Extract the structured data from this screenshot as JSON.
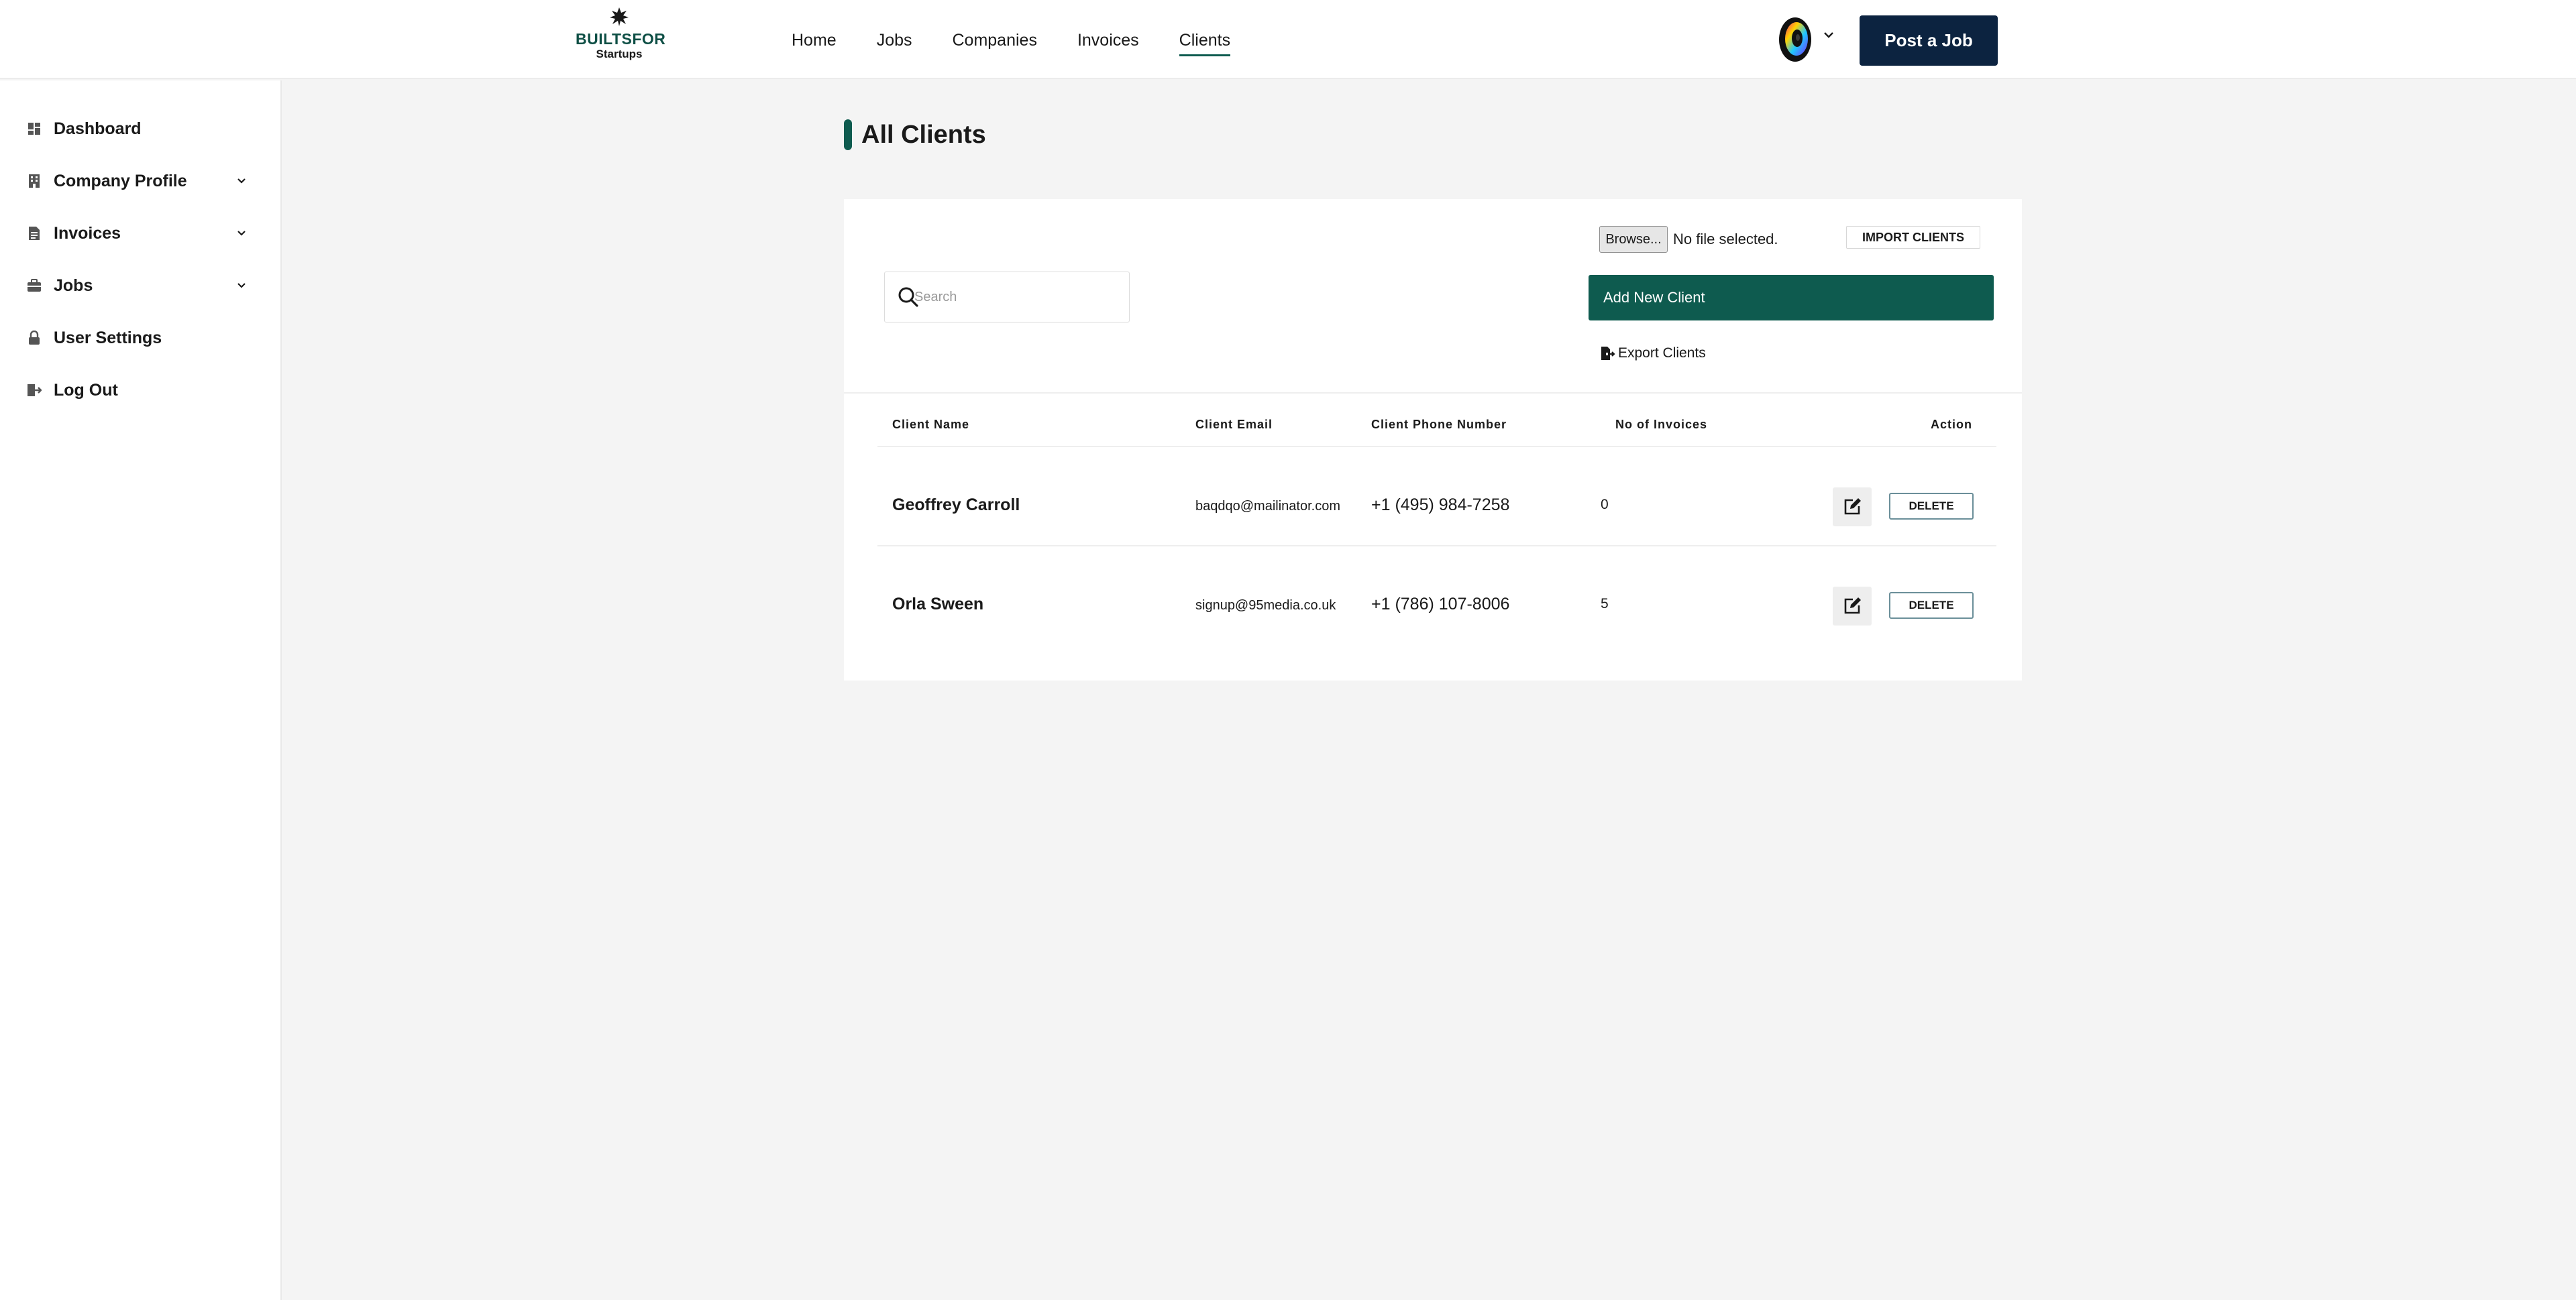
{
  "header": {
    "logo": {
      "line1": "BUILTSFOR",
      "line2": "Startups"
    },
    "nav": [
      {
        "label": "Home",
        "active": false
      },
      {
        "label": "Jobs",
        "active": false
      },
      {
        "label": "Companies",
        "active": false
      },
      {
        "label": "Invoices",
        "active": false
      },
      {
        "label": "Clients",
        "active": true
      }
    ],
    "post_job_label": "Post a Job"
  },
  "sidebar": {
    "items": [
      {
        "label": "Dashboard",
        "icon": "dashboard-icon",
        "expandable": false
      },
      {
        "label": "Company Profile",
        "icon": "building-icon",
        "expandable": true
      },
      {
        "label": "Invoices",
        "icon": "document-icon",
        "expandable": true
      },
      {
        "label": "Jobs",
        "icon": "briefcase-icon",
        "expandable": true
      },
      {
        "label": "User Settings",
        "icon": "lock-icon",
        "expandable": false
      },
      {
        "label": "Log Out",
        "icon": "logout-icon",
        "expandable": false
      }
    ]
  },
  "main": {
    "title": "All Clients",
    "file_input": {
      "browse_label": "Browse...",
      "status": "No file selected."
    },
    "import_label": "IMPORT CLIENTS",
    "search": {
      "placeholder": "Search",
      "value": ""
    },
    "add_client_label": "Add New Client",
    "export_label": "Export Clients",
    "table": {
      "columns": [
        "Client Name",
        "Client Email",
        "Client Phone Number",
        "No of Invoices",
        "Action"
      ],
      "rows": [
        {
          "name": "Geoffrey Carroll",
          "email": "baqdqo@mailinator.com",
          "phone": "+1 (495) 984-7258",
          "invoices": "0"
        },
        {
          "name": "Orla Sween",
          "email": "signup@95media.co.uk",
          "phone": "+1 (786) 107-8006",
          "invoices": "5"
        }
      ],
      "delete_label": "DELETE"
    }
  },
  "colors": {
    "brand_green": "#0e5b4f",
    "navy": "#0c2340",
    "page_bg": "#f4f4f4"
  }
}
